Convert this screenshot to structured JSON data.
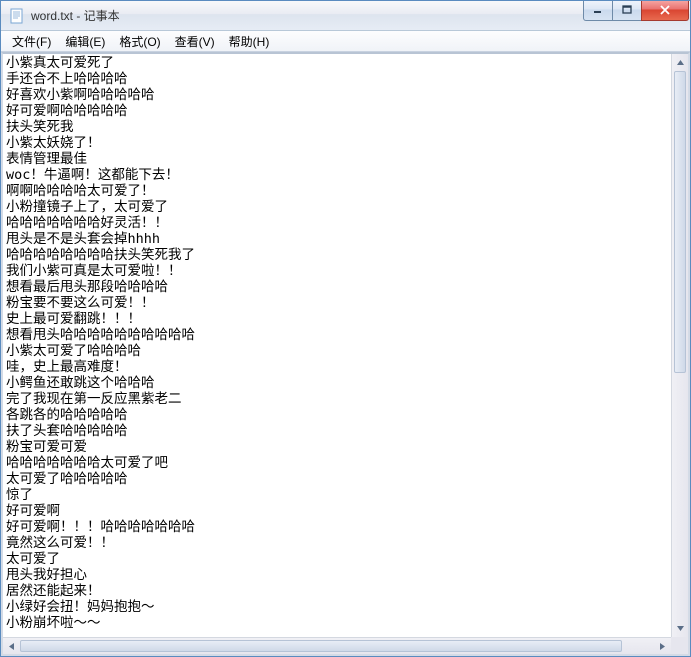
{
  "window": {
    "title": "word.txt - 记事本"
  },
  "menu": {
    "items": [
      {
        "label": "文件(F)"
      },
      {
        "label": "编辑(E)"
      },
      {
        "label": "格式(O)"
      },
      {
        "label": "查看(V)"
      },
      {
        "label": "帮助(H)"
      }
    ]
  },
  "document": {
    "lines": [
      "小紫真太可爱死了",
      "手还合不上哈哈哈哈",
      "好喜欢小紫啊哈哈哈哈哈",
      "好可爱啊哈哈哈哈哈",
      "扶头笑死我",
      "小紫太妖娆了！",
      "表情管理最佳",
      "woc！牛逼啊！这都能下去！",
      "啊啊哈哈哈哈太可爱了！",
      "小粉撞镜子上了，太可爱了",
      "哈哈哈哈哈哈哈好灵活！！",
      "甩头是不是头套会掉hhhh",
      "哈哈哈哈哈哈哈哈扶头笑死我了",
      "我们小紫可真是太可爱啦！！",
      "想看最后甩头那段哈哈哈哈",
      "粉宝要不要这么可爱！！",
      "史上最可爱翻跳！！！",
      "想看甩头哈哈哈哈哈哈哈哈哈哈",
      "小紫太可爱了哈哈哈哈",
      "哇，史上最高难度！",
      "小鳄鱼还敢跳这个哈哈哈",
      "完了我现在第一反应黑紫老二",
      "各跳各的哈哈哈哈哈",
      "扶了头套哈哈哈哈哈",
      "粉宝可爱可爱",
      "哈哈哈哈哈哈哈太可爱了吧",
      "太可爱了哈哈哈哈哈",
      "惊了",
      "好可爱啊",
      "好可爱啊！！！哈哈哈哈哈哈哈",
      "竟然这么可爱！！",
      "太可爱了",
      "甩头我好担心",
      "居然还能起来！",
      "小绿好会扭！妈妈抱抱～",
      "小粉崩坏啦～～"
    ]
  }
}
